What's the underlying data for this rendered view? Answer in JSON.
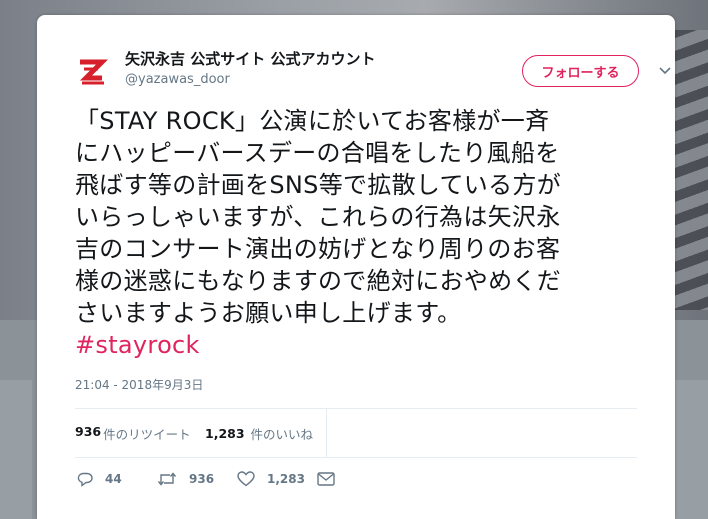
{
  "account": {
    "display_name": "矢沢永吉 公式サイト 公式アカウント",
    "handle": "@yazawas_door",
    "follow_label": "フォローする"
  },
  "tweet": {
    "text_lines": [
      "「STAY ROCK」公演に於いてお客様が一斉",
      "にハッピーバースデーの合唱をしたり風船を",
      "飛ばす等の計画をSNS等で拡散している方が",
      "いらっしゃいますが、これらの行為は矢沢永",
      "吉のコンサート演出の妨げとなり周りのお客",
      "様の迷惑にもなりますので絶対におやめくだ",
      "さいますようお願い申し上げます。"
    ],
    "hashtag": "#stayrock",
    "timestamp": "21:04 - 2018年9月3日"
  },
  "stats": {
    "retweet_count": "936",
    "retweet_label": "件のリツイート",
    "like_count": "1,283",
    "like_label": " 件のいいね"
  },
  "actions": {
    "reply_count": "44",
    "retweet_count": "936",
    "like_count": "1,283"
  },
  "colors": {
    "accent": "#e0245e",
    "text": "#14171a",
    "muted": "#657786"
  }
}
